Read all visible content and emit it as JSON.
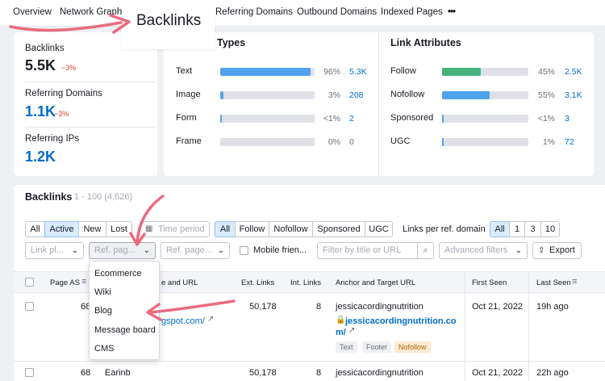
{
  "topnav": {
    "items": [
      "Overview",
      "Network Graph",
      "Referring Domains",
      "Outbound Domains",
      "Indexed Pages",
      "•••"
    ]
  },
  "callout": {
    "text": "Backlinks"
  },
  "summary": {
    "backlinks": {
      "label": "Backlinks",
      "value": "5.5K",
      "delta": "−3%"
    },
    "referring_domains": {
      "label": "Referring Domains",
      "value": "1.1K",
      "delta": "−3%"
    },
    "referring_ips": {
      "label": "Referring IPs",
      "value": "1.2K"
    }
  },
  "types": {
    "title": "Types",
    "rows": [
      {
        "label": "Text",
        "pct": "96%",
        "count": "5.3K",
        "fill": 0.96
      },
      {
        "label": "Image",
        "pct": "3%",
        "count": "208",
        "fill": 0.03
      },
      {
        "label": "Form",
        "pct": "<1%",
        "count": "2",
        "fill": 0.01
      },
      {
        "label": "Frame",
        "pct": "0%",
        "count": "0",
        "fill": 0
      }
    ]
  },
  "link_attributes": {
    "title": "Link Attributes",
    "rows": [
      {
        "label": "Follow",
        "pct": "45%",
        "count": "2.5K",
        "fill": 0.45,
        "color": "#45b37c"
      },
      {
        "label": "Nofollow",
        "pct": "55%",
        "count": "3.1K",
        "fill": 0.55,
        "color": "#4fa3ec"
      },
      {
        "label": "Sponsored",
        "pct": "<1%",
        "count": "3",
        "fill": 0.01,
        "color": "#4fa3ec"
      },
      {
        "label": "UGC",
        "pct": "1%",
        "count": "72",
        "fill": 0.01,
        "color": "#4fa3ec"
      }
    ]
  },
  "backlinks_section": {
    "title": "Backlinks",
    "range": "1 - 100 (4,626)"
  },
  "filters": {
    "status": [
      "All",
      "Active",
      "New",
      "Lost"
    ],
    "time_period": "Time period",
    "attr": [
      "All",
      "Follow",
      "Nofollow",
      "Sponsored",
      "UGC"
    ],
    "links_per_label": "Links per ref. domain",
    "links_per": [
      "All",
      "1",
      "3",
      "10"
    ],
    "link_placeholder": "Link pl...",
    "ref_page_placeholder": "Ref. pag...",
    "ref_page2_placeholder": "Ref. page...",
    "mobile_friendly": "Mobile frien...",
    "search_placeholder": "Filter by title or URL",
    "advanced": "Advanced filters",
    "export": "Export"
  },
  "dropdown_menu": {
    "items": [
      "Ecommerce",
      "Wiki",
      "Blog",
      "Message board",
      "CMS"
    ]
  },
  "table": {
    "headers": [
      "Page AS",
      "Title and URL",
      "Ext. Links",
      "Int. Links",
      "Anchor and Target URL",
      "First Seen",
      "Last Seen"
    ],
    "title_partial": "e and URL",
    "rows": [
      {
        "page_as": "68",
        "title_url": "gspot.com/",
        "ext": "50,178",
        "int": "8",
        "anchor": "jessicacordingnutrition",
        "target_line1": "jessicacordingnutrition.co",
        "target_line2": "m/",
        "tags": [
          "Text",
          "Footer",
          "Nofollow"
        ],
        "first": "Oct 21, 2022",
        "last": "19h ago"
      },
      {
        "page_as": "68",
        "title_url": "Earinb",
        "ext": "50,178",
        "int": "8",
        "anchor": "jessicacordingnutrition",
        "first": "Oct 21, 2022",
        "last": "22h ago"
      }
    ]
  },
  "colors": {
    "accent": "#006dca",
    "arrow": "#ea6b7f",
    "delta": "#d1402e"
  }
}
